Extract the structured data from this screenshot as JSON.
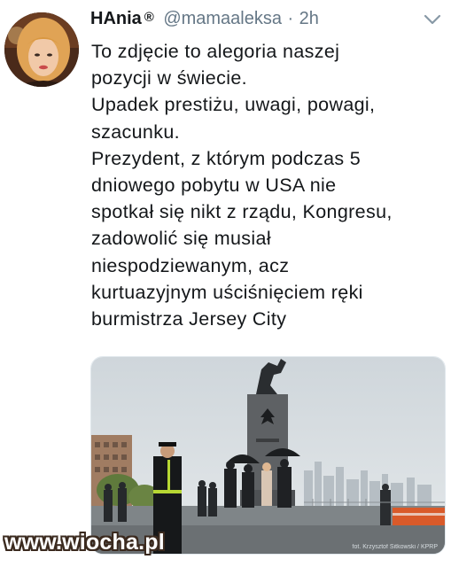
{
  "tweet": {
    "author_name": "HAnia",
    "badge": "®",
    "handle": "@mamaaleksa",
    "separator": "·",
    "time": "2h",
    "text_lines": [
      "To zdjęcie to alegoria naszej",
      "pozycji w świecie.",
      "Upadek prestiżu, uwagi, powagi,",
      "szacunku.",
      "Prezydent, z którym podczas 5",
      "dniowego pobytu w USA nie",
      "spotkał się nikt z rządu, Kongresu,",
      "zadowolić się musiał",
      "niespodziewanym, acz",
      "kurtuazyjnym uściśnięciem ręki",
      "burmistrza Jersey City"
    ],
    "photo_credit": "fot. Krzysztof Sitkowski / KPRP"
  },
  "watermark": "www.wiocha.pl",
  "icons": {
    "avatar": "avatar",
    "menu": "chevron-down-icon"
  },
  "colors": {
    "text": "#14171a",
    "secondary": "#657786",
    "border": "#e1e8ed"
  }
}
